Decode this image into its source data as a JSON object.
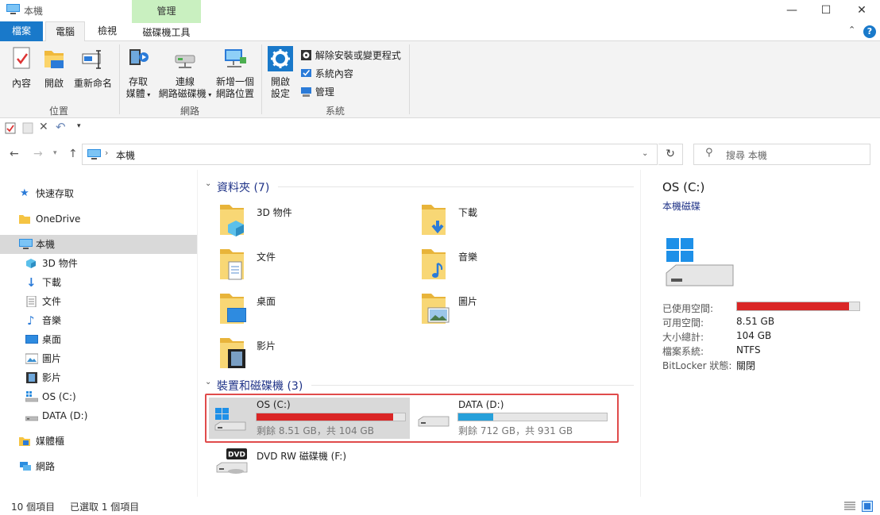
{
  "window": {
    "title": "本機",
    "context_tab": "管理"
  },
  "controls": {
    "minimize": "—",
    "maximize": "☐",
    "close": "✕",
    "help": "?"
  },
  "tabs": {
    "file": "檔案",
    "computer": "電腦",
    "view": "檢視",
    "disk_tools": "磁碟機工具"
  },
  "ribbon": {
    "location": {
      "properties": "內容",
      "open": "開啟",
      "rename": "重新命名",
      "label": "位置"
    },
    "network": {
      "media_line1": "存取",
      "media_line2": "媒體",
      "map_line1": "連線",
      "map_line2": "網路磁碟機",
      "add_line1": "新增一個",
      "add_line2": "網路位置",
      "label": "網路"
    },
    "system": {
      "settings_line1": "開啟",
      "settings_line2": "設定",
      "uninstall": "解除安裝或變更程式",
      "sysprops": "系統內容",
      "manage": "管理",
      "label": "系統"
    }
  },
  "address": {
    "path": "本機",
    "search_placeholder": "搜尋 本機"
  },
  "nav": {
    "quick_access": "快速存取",
    "onedrive": "OneDrive",
    "this_pc": "本機",
    "objects3d": "3D 物件",
    "downloads": "下載",
    "documents": "文件",
    "music": "音樂",
    "desktop": "桌面",
    "pictures": "圖片",
    "videos": "影片",
    "drive_c": "OS (C:)",
    "drive_d": "DATA (D:)",
    "libraries": "媒體櫃",
    "network": "網路"
  },
  "content": {
    "folders_header": "資料夾 (7)",
    "folders": [
      "3D 物件",
      "下載",
      "文件",
      "音樂",
      "桌面",
      "圖片",
      "影片"
    ],
    "devices_header": "裝置和磁碟機 (3)",
    "drives": [
      {
        "name": "OS (C:)",
        "free": "剩餘 8.51 GB，共 104 GB",
        "used_fraction": 0.918,
        "bar_color": "#da2626"
      },
      {
        "name": "DATA (D:)",
        "free": "剩餘 712 GB，共 931 GB",
        "used_fraction": 0.235,
        "bar_color": "#26a0da"
      },
      {
        "name": "DVD RW 磁碟機 (F:)"
      }
    ]
  },
  "details": {
    "title": "OS (C:)",
    "subtitle": "本機磁碟",
    "used_label": "已使用空間:",
    "used_fraction": 0.918,
    "free_label": "可用空間:",
    "free_value": "8.51 GB",
    "total_label": "大小總計:",
    "total_value": "104 GB",
    "fs_label": "檔案系統:",
    "fs_value": "NTFS",
    "bitlocker_label": "BitLocker 狀態:",
    "bitlocker_value": "關閉"
  },
  "status": {
    "items": "10 個項目",
    "selected": "已選取 1 個項目"
  },
  "colors": {
    "accent": "#1979ca",
    "context_green": "#c9f0c0",
    "selection_outline": "#e04b4b"
  }
}
